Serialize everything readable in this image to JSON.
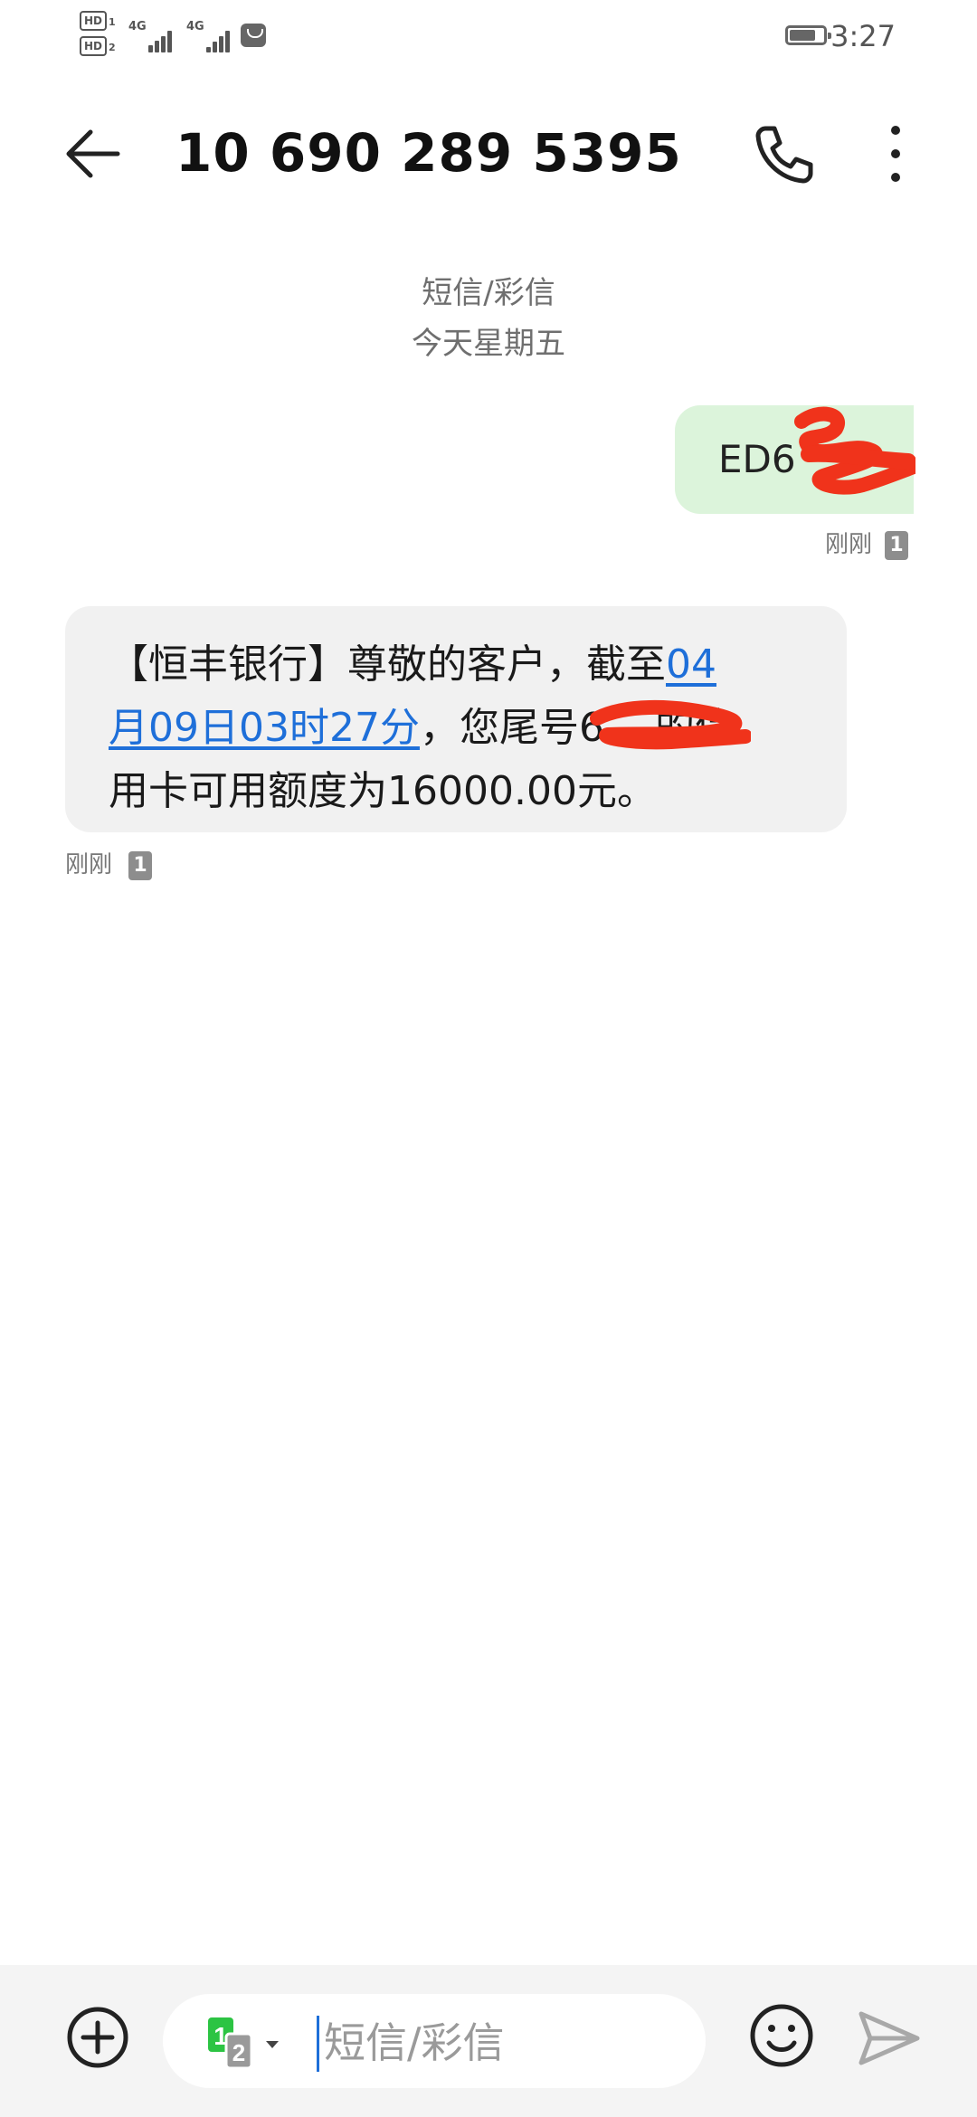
{
  "status_bar": {
    "hd1": "HD",
    "hd1_sub": "1",
    "hd2": "HD",
    "hd2_sub": "2",
    "net1": "4G",
    "net2": "4G",
    "app_badge_icon": "huawei-app-icon",
    "battery_icon": "battery-icon",
    "battery_level": 0.7,
    "time": "3:27"
  },
  "header": {
    "back_icon": "back-arrow-icon",
    "title": "10 690 289 5395",
    "call_icon": "phone-icon",
    "more_icon": "more-vertical-icon"
  },
  "conversation": {
    "channel": "短信/彩信",
    "date": "今天星期五",
    "messages": [
      {
        "direction": "outgoing",
        "text": "ED6",
        "redacted": true,
        "time": "刚刚",
        "sim": "1"
      },
      {
        "direction": "incoming",
        "text_prefix": "【恒丰银行】尊敬的客户，截至",
        "link_text_1": "04",
        "link_text_2": "月09日03时27分",
        "text_mid": "，您尾号",
        "card_digits": "6",
        "text_suffix_1": "的信",
        "text_suffix_2": "用卡可用额度为16000.00元。",
        "redacted": true,
        "time": "刚刚",
        "sim": "1"
      }
    ]
  },
  "composer": {
    "add_icon": "add-circle-icon",
    "sim_primary": "1",
    "sim_secondary": "2",
    "placeholder": "短信/彩信",
    "emoji_icon": "emoji-icon",
    "send_icon": "send-icon"
  },
  "colors": {
    "outgoing_bubble": "#dcf4db",
    "incoming_bubble": "#f1f1f1",
    "link": "#1e6fd9",
    "redaction": "#f0331b",
    "sim_green": "#2cc443"
  }
}
